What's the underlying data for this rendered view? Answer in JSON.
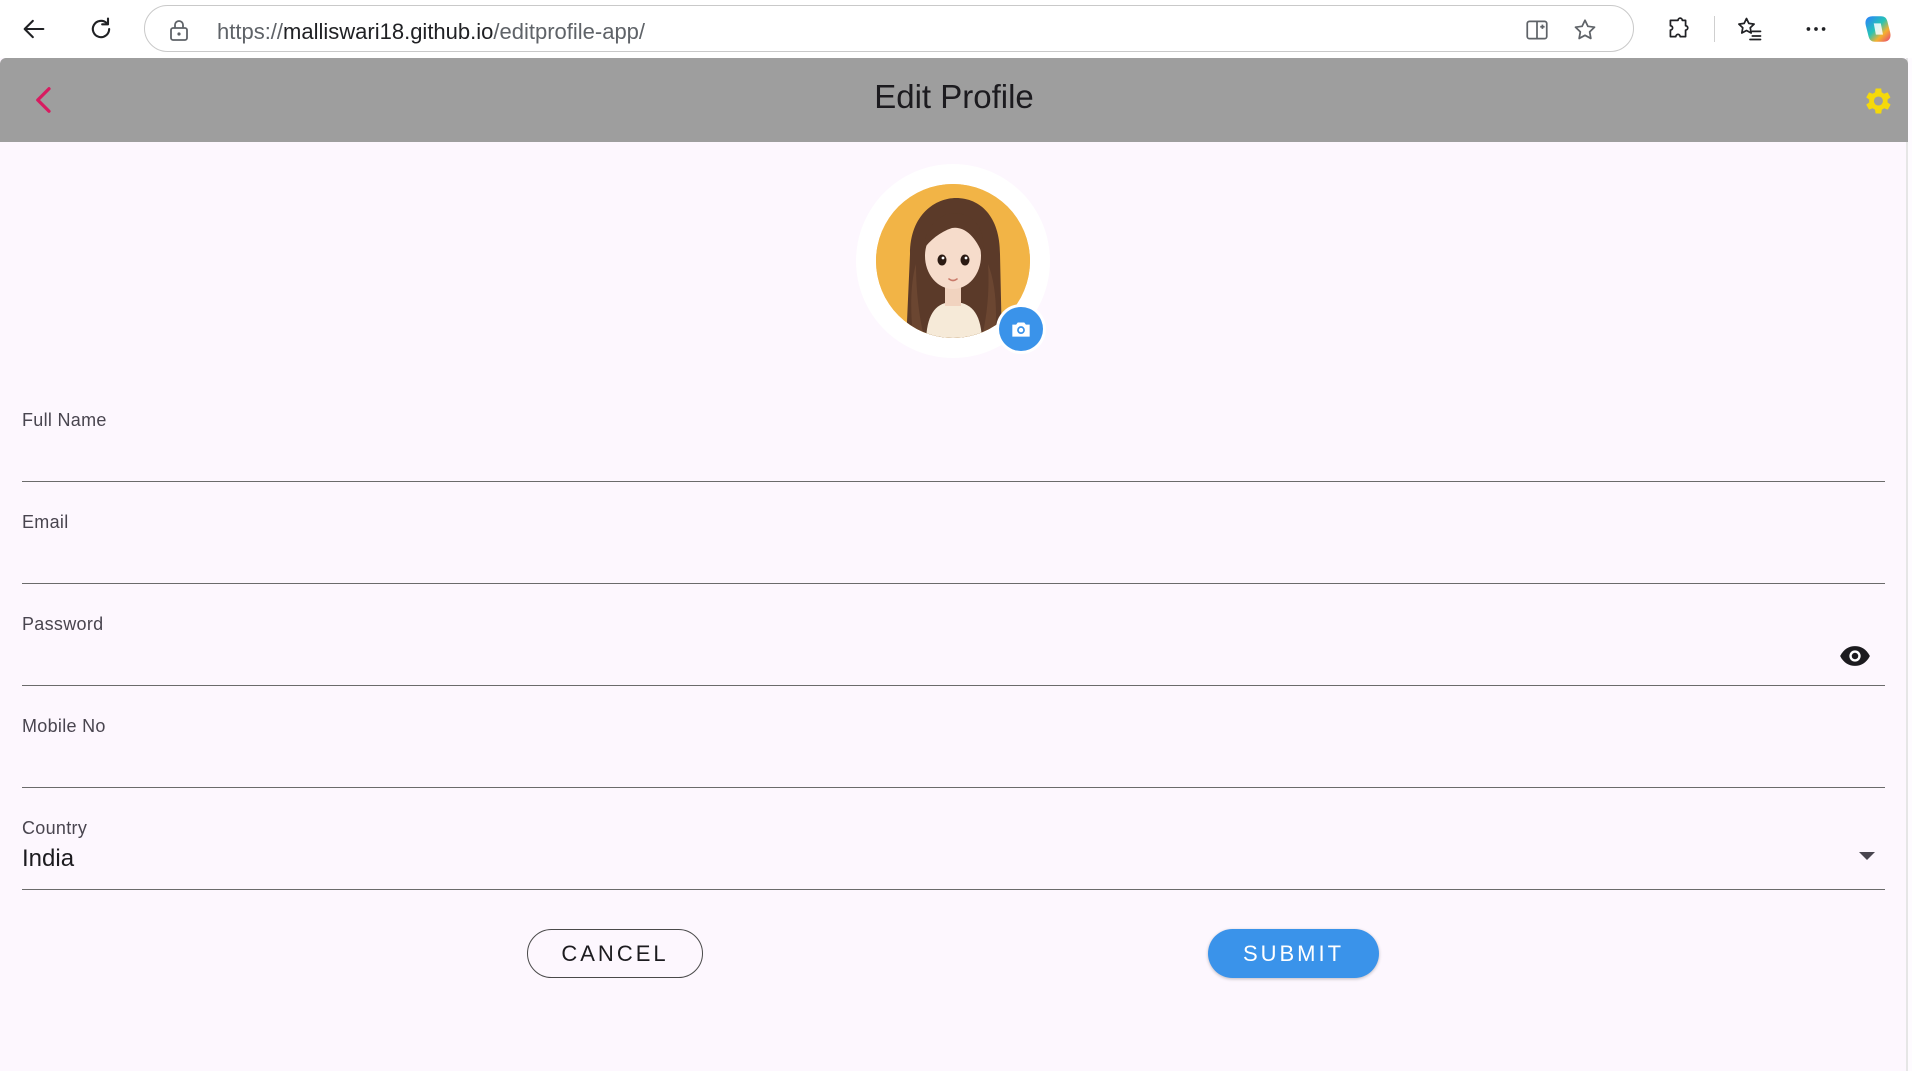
{
  "browser": {
    "url_scheme": "https://",
    "url_host": "malliswari18.github.io",
    "url_path": "/editprofile-app/",
    "icons": {
      "back": "arrow-left-icon",
      "refresh": "refresh-icon",
      "lock": "lock-icon",
      "split": "split-screen-icon",
      "favorite": "star-icon",
      "extensions": "puzzle-icon",
      "favorites": "favorites-list-icon",
      "more": "more-dots-icon",
      "copilot": "copilot-icon"
    }
  },
  "appbar": {
    "title": "Edit Profile",
    "background": "#9e9e9e",
    "back_color": "#d81b60",
    "settings_color": "#f5d90a"
  },
  "profile": {
    "avatar_bg": "#f2b446",
    "camera_color": "#3a93ea"
  },
  "form": {
    "full_name": {
      "label": "Full Name",
      "value": ""
    },
    "email": {
      "label": "Email",
      "value": ""
    },
    "password": {
      "label": "Password",
      "value": ""
    },
    "mobile": {
      "label": "Mobile No",
      "value": ""
    },
    "country": {
      "label": "Country",
      "value": "India"
    }
  },
  "actions": {
    "cancel_label": "CANCEL",
    "submit_label": "SUBMIT",
    "submit_color": "#3a93ea"
  }
}
